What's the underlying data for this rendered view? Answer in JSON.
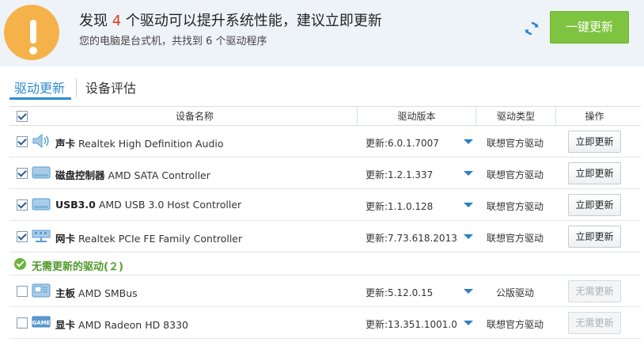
{
  "header": {
    "title_prefix": "发现 ",
    "title_count": "4",
    "title_suffix": " 个驱动可以提升系统性能，建议立即更新",
    "subtitle": "您的电脑是台式机，共找到 6 个驱动程序",
    "update_all_label": "一键更新",
    "colors": {
      "accent_green": "#7ec440",
      "warning_orange": "#f6b24a",
      "count_red": "#e0381e",
      "link_blue": "#2f8ad0"
    }
  },
  "tabs": [
    {
      "label": "驱动更新",
      "active": true
    },
    {
      "label": "设备评估",
      "active": false
    }
  ],
  "table": {
    "select_all_checked": true,
    "columns": [
      "设备名称",
      "驱动版本",
      "驱动类型",
      "操作"
    ]
  },
  "updatable": [
    {
      "icon": "speaker-icon",
      "checked": true,
      "category": "声卡",
      "name": "Realtek High Definition Audio",
      "version": "更新:6.0.1.7007",
      "type": "联想官方驱动",
      "action": "立即更新"
    },
    {
      "icon": "disk-controller-icon",
      "checked": true,
      "category": "磁盘控制器",
      "name": "AMD SATA Controller",
      "version": "更新:1.2.1.337",
      "type": "联想官方驱动",
      "action": "立即更新"
    },
    {
      "icon": "usb-controller-icon",
      "checked": true,
      "category": "USB3.0",
      "name": "AMD USB 3.0 Host Controller",
      "version": "更新:1.1.0.128",
      "type": "联想官方驱动",
      "action": "立即更新"
    },
    {
      "icon": "network-card-icon",
      "checked": true,
      "category": "网卡",
      "name": "Realtek PCIe FE Family Controller",
      "version": "更新:7.73.618.2013",
      "type": "联想官方驱动",
      "action": "立即更新"
    }
  ],
  "no_update_group": {
    "label": "无需更新的驱动(２)"
  },
  "up_to_date": [
    {
      "icon": "motherboard-icon",
      "checked": false,
      "category": "主板",
      "name": "AMD SMBus",
      "version": "更新:5.12.0.15",
      "type": "公版驱动",
      "action": "无需更新"
    },
    {
      "icon": "graphics-card-icon",
      "checked": false,
      "category": "显卡",
      "name": "AMD Radeon HD 8330",
      "version": "更新:13.351.1001.0",
      "type": "联想官方驱动",
      "action": "无需更新"
    }
  ]
}
